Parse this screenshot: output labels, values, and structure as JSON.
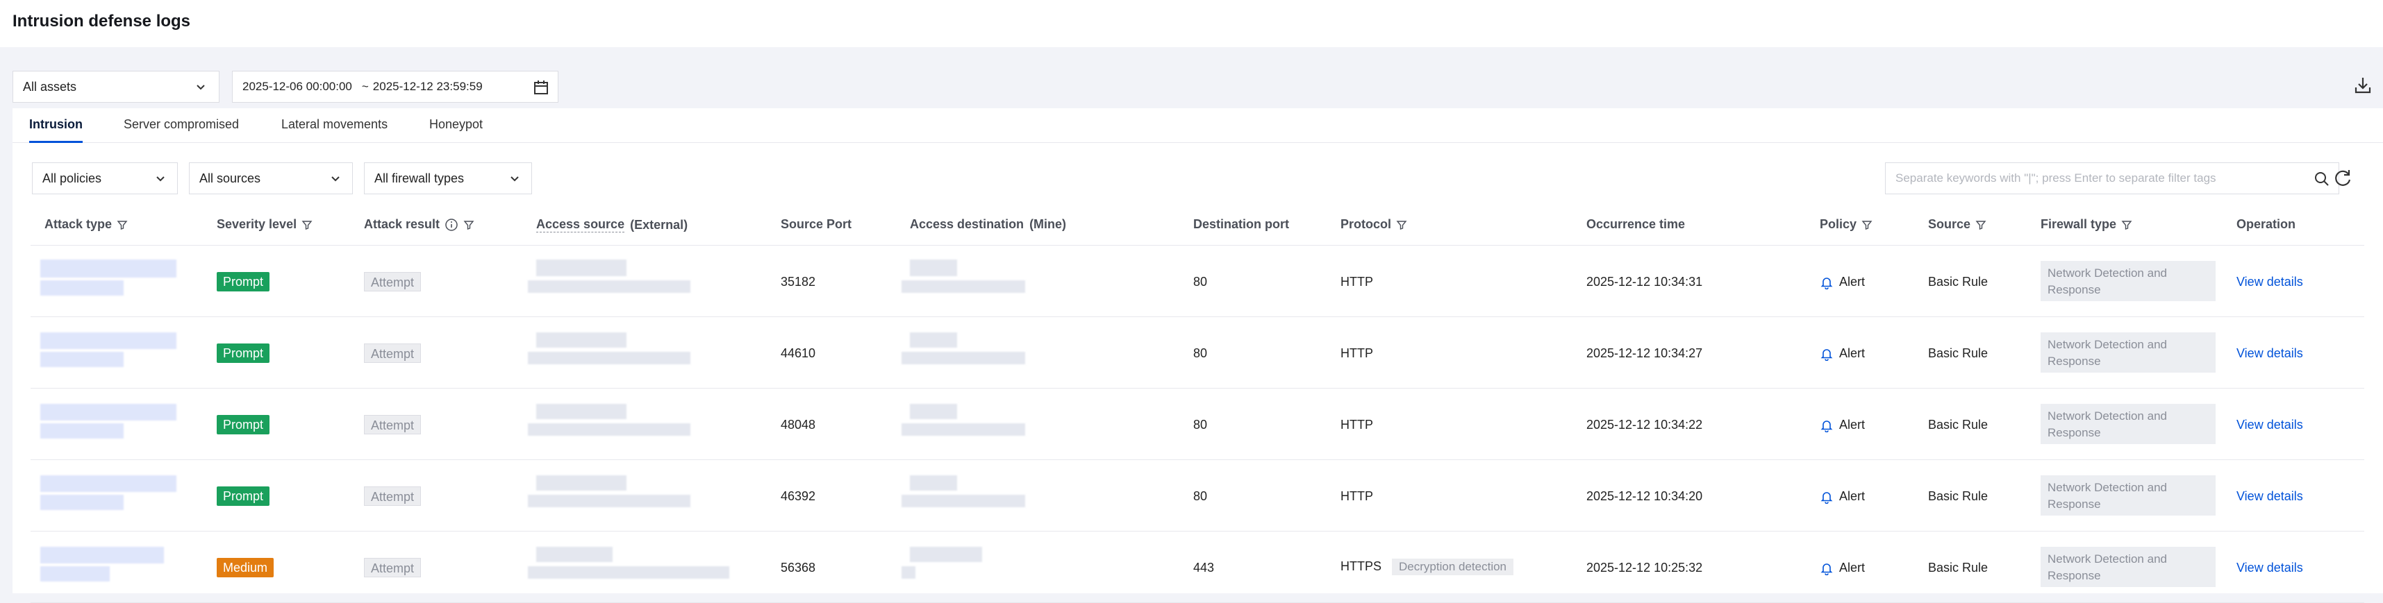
{
  "header": {
    "title": "Intrusion defense logs"
  },
  "filters": {
    "asset": "All assets",
    "date_start": "2025-12-06 00:00:00",
    "date_sep": "~",
    "date_end": "2025-12-12 23:59:59"
  },
  "tabs": [
    {
      "label": "Intrusion",
      "active": true
    },
    {
      "label": "Server compromised",
      "active": false
    },
    {
      "label": "Lateral movements",
      "active": false
    },
    {
      "label": "Honeypot",
      "active": false
    }
  ],
  "sub_filters": {
    "policies": "All policies",
    "sources": "All sources",
    "firewall_types": "All firewall types",
    "search_placeholder": "Separate keywords with \"|\"; press Enter to separate filter tags"
  },
  "columns": {
    "attack_type": "Attack type",
    "severity": "Severity level",
    "result": "Attack result",
    "access_source": "Access source",
    "access_source_suffix": "(External)",
    "source_port": "Source Port",
    "access_destination": "Access destination",
    "access_destination_suffix": "(Mine)",
    "destination_port": "Destination port",
    "protocol": "Protocol",
    "occurrence_time": "Occurrence time",
    "policy": "Policy",
    "source": "Source",
    "firewall_type": "Firewall type",
    "operation": "Operation"
  },
  "rows": [
    {
      "severity": "Prompt",
      "severity_color": "#1aa05c",
      "result": "Attempt",
      "source_port": "35182",
      "destination_port": "80",
      "protocol": "HTTP",
      "protocol_tag": "",
      "time": "2025-12-12 10:34:31",
      "policy": "Alert",
      "source": "Basic Rule",
      "firewall_type": "Network Detection and Response",
      "operation": "View details"
    },
    {
      "severity": "Prompt",
      "severity_color": "#1aa05c",
      "result": "Attempt",
      "source_port": "44610",
      "destination_port": "80",
      "protocol": "HTTP",
      "protocol_tag": "",
      "time": "2025-12-12 10:34:27",
      "policy": "Alert",
      "source": "Basic Rule",
      "firewall_type": "Network Detection and Response",
      "operation": "View details"
    },
    {
      "severity": "Prompt",
      "severity_color": "#1aa05c",
      "result": "Attempt",
      "source_port": "48048",
      "destination_port": "80",
      "protocol": "HTTP",
      "protocol_tag": "",
      "time": "2025-12-12 10:34:22",
      "policy": "Alert",
      "source": "Basic Rule",
      "firewall_type": "Network Detection and Response",
      "operation": "View details"
    },
    {
      "severity": "Prompt",
      "severity_color": "#1aa05c",
      "result": "Attempt",
      "source_port": "46392",
      "destination_port": "80",
      "protocol": "HTTP",
      "protocol_tag": "",
      "time": "2025-12-12 10:34:20",
      "policy": "Alert",
      "source": "Basic Rule",
      "firewall_type": "Network Detection and Response",
      "operation": "View details"
    },
    {
      "severity": "Medium",
      "severity_color": "#e37d10",
      "result": "Attempt",
      "source_port": "56368",
      "destination_port": "443",
      "protocol": "HTTPS",
      "protocol_tag": "Decryption detection",
      "time": "2025-12-12 10:25:32",
      "policy": "Alert",
      "source": "Basic Rule",
      "firewall_type": "Network Detection and Response",
      "operation": "View details"
    }
  ],
  "colors": {
    "accent": "#0052d9",
    "prompt": "#1aa05c",
    "medium": "#e37d10"
  },
  "icons": [
    "chevron-down-icon",
    "calendar-icon",
    "download-icon",
    "search-icon",
    "refresh-icon",
    "filter-icon",
    "info-icon",
    "bell-icon"
  ]
}
